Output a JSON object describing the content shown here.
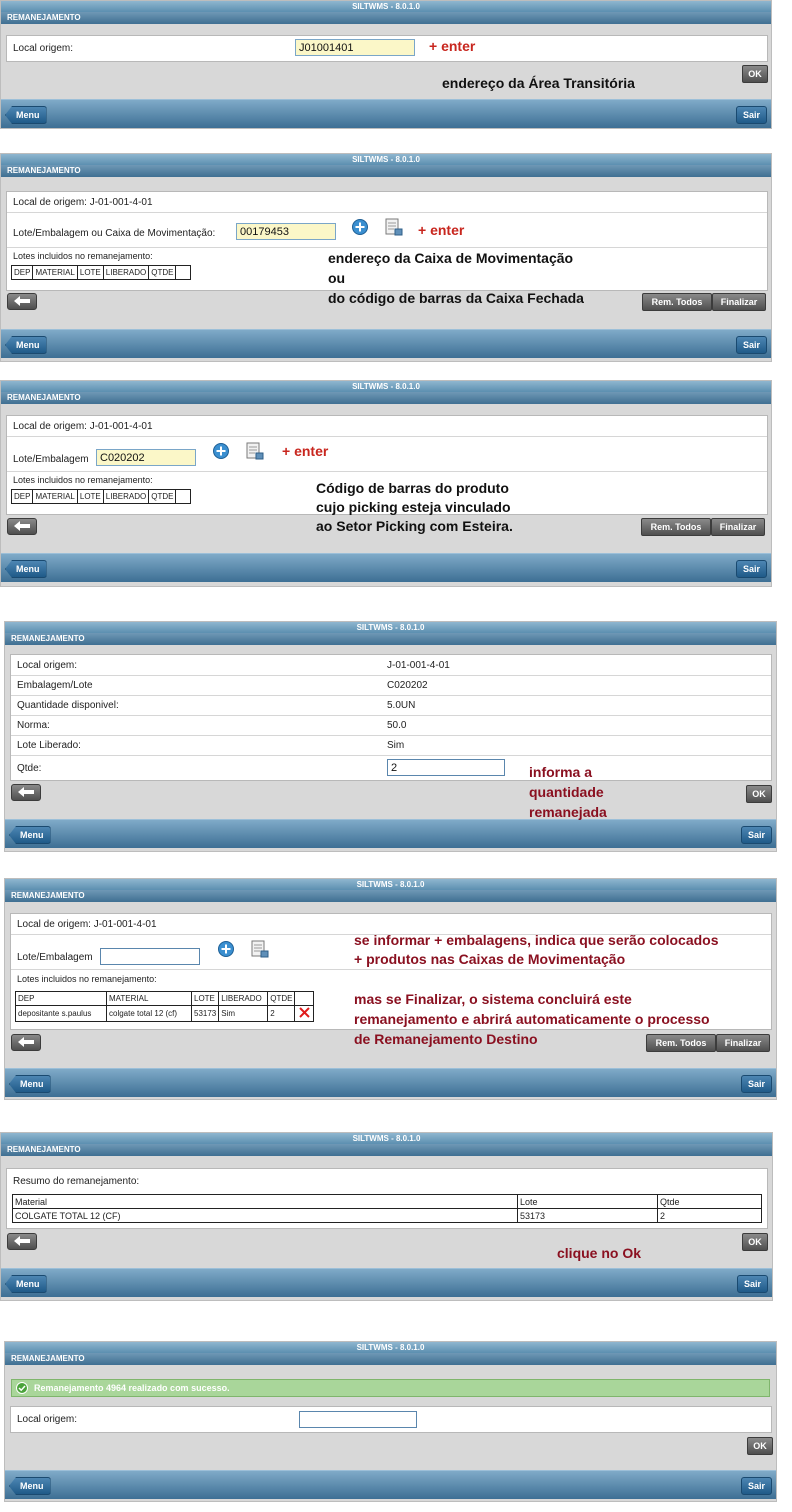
{
  "app_title": "SILTWMS - 8.0.1.0",
  "section_title": "REMANEJAMENTO",
  "menu_label": "Menu",
  "sair_label": "Sair",
  "ok_label": "OK",
  "rem_todos_label": "Rem. Todos",
  "finalizar_label": "Finalizar",
  "screen1": {
    "local_origem_label": "Local origem:",
    "local_origem_value": "J01001401",
    "annotation_enter": "+ enter",
    "annotation": "endereço da Área Transitória"
  },
  "screen2": {
    "local_de_origem": "Local de origem: J-01-001-4-01",
    "lote_label": "Lote/Embalagem ou Caixa de Movimentação:",
    "lote_value": "00179453",
    "annotation_enter": "+ enter",
    "lotes_label": "Lotes incluidos no remanejamento:",
    "columns": [
      "DEP",
      "MATERIAL",
      "LOTE",
      "LIBERADO",
      "QTDE",
      ""
    ],
    "annotation_lines": [
      "endereço da Caixa de Movimentação",
      "ou",
      "do código de barras da Caixa Fechada"
    ]
  },
  "screen3": {
    "local_de_origem": "Local de origem: J-01-001-4-01",
    "lote_label": "Lote/Embalagem",
    "lote_value": "C020202",
    "annotation_enter": "+ enter",
    "lotes_label": "Lotes incluidos no remanejamento:",
    "columns": [
      "DEP",
      "MATERIAL",
      "LOTE",
      "LIBERADO",
      "QTDE",
      ""
    ],
    "annotation_lines": [
      "Código de barras do produto",
      "cujo picking esteja vinculado",
      "ao Setor Picking com Esteira."
    ]
  },
  "screen4": {
    "rows": [
      {
        "label": "Local origem:",
        "value": "J-01-001-4-01"
      },
      {
        "label": "Embalagem/Lote",
        "value": "C020202"
      },
      {
        "label": "Quantidade disponivel:",
        "value": "5.0UN"
      },
      {
        "label": "Norma:",
        "value": "50.0"
      },
      {
        "label": "Lote Liberado:",
        "value": "Sim"
      }
    ],
    "qtde_label": "Qtde:",
    "qtde_value": "2",
    "annotation_lines": [
      "informa a",
      "quantidade",
      "remanejada"
    ]
  },
  "screen5": {
    "local_de_origem": "Local de origem: J-01-001-4-01",
    "lote_label": "Lote/Embalagem",
    "lote_value": "",
    "lotes_label": "Lotes incluidos no remanejamento:",
    "columns": [
      "DEP",
      "MATERIAL",
      "LOTE",
      "LIBERADO",
      "QTDE",
      ""
    ],
    "row": [
      "depositante s.paulus",
      "colgate total 12 (cf)",
      "53173",
      "Sim",
      "2"
    ],
    "annotation_lines_a": [
      "se informar + embalagens, indica que serão colocados",
      "+ produtos nas Caixas de Movimentação"
    ],
    "annotation_lines_b": [
      "mas se Finalizar, o sistema concluirá este",
      "remanejamento e abrirá automaticamente o processo",
      "de Remanejamento Destino"
    ]
  },
  "screen6": {
    "resumo_label": "Resumo do remanejamento:",
    "columns": [
      "Material",
      "Lote",
      "Qtde"
    ],
    "row": [
      "COLGATE TOTAL 12 (CF)",
      "53173",
      "2"
    ],
    "annotation": "clique no Ok"
  },
  "screen7": {
    "success_message": "Remanejamento 4964 realizado com sucesso.",
    "local_origem_label": "Local origem:",
    "local_origem_value": ""
  }
}
